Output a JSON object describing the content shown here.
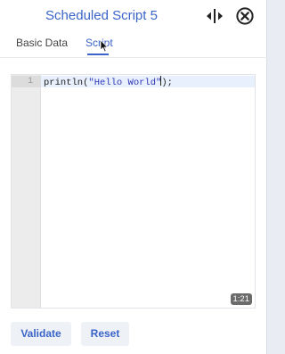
{
  "header": {
    "title": "Scheduled Script 5",
    "resize_icon": "horizontal-resize-icon",
    "close_icon": "close-circle-icon"
  },
  "tabs": [
    {
      "label": "Basic Data",
      "active": false
    },
    {
      "label": "Script",
      "active": true
    }
  ],
  "editor": {
    "lines": [
      {
        "number": "1",
        "code_prefix": "println(",
        "code_string": "\"Hello World\"",
        "code_suffix": ");"
      }
    ],
    "cursor_position": "1:21"
  },
  "actions": {
    "validate_label": "Validate",
    "reset_label": "Reset"
  },
  "colors": {
    "accent": "#3a64c8",
    "string": "#2e37b8"
  }
}
